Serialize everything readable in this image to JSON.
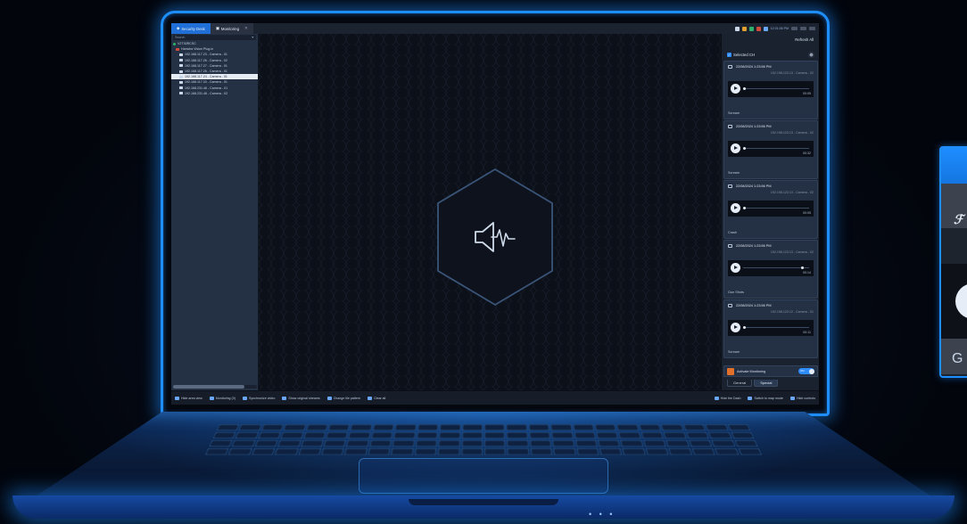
{
  "titlebar": {
    "tabs": [
      {
        "label": "Security Desk",
        "active": true
      },
      {
        "label": "Monitoring",
        "active": false
      }
    ],
    "clock": "12:31:06 PM"
  },
  "left_panel": {
    "search_placeholder": "Search",
    "tree": [
      {
        "label": "V2T30RCSC",
        "kind": "root"
      },
      {
        "label": "Hanwha Vision Plug-in",
        "kind": "plugin"
      },
      {
        "label": "192.168.117.23 - Camera - 01",
        "kind": "camera"
      },
      {
        "label": "192.168.117.26 - Camera - 02",
        "kind": "camera"
      },
      {
        "label": "192.168.117.27 - Camera - 01",
        "kind": "camera"
      },
      {
        "label": "192.168.117.26 - Camera - 01",
        "kind": "camera"
      },
      {
        "label": "192.168.117.24 - Camera - 01",
        "kind": "camera",
        "selected": true
      },
      {
        "label": "192.168.117.33 - Camera - 01",
        "kind": "camera"
      },
      {
        "label": "192.168.231.46 - Camera - 01",
        "kind": "camera"
      },
      {
        "label": "192.168.231.46 - Camera - 02",
        "kind": "camera"
      }
    ]
  },
  "right_panel": {
    "refresh_label": "Refresh All",
    "selected_label": "Selected CH",
    "events": [
      {
        "time": "22/08/2024 1:23:56 PM",
        "camera": "192.198.123.13 - Camera - 02",
        "duration": "00:05",
        "type": "Scream",
        "progress": 0.02
      },
      {
        "time": "22/08/2024 1:23:56 PM",
        "camera": "192.198.123.13 - Camera - 02",
        "duration": "00:32",
        "type": "Scream",
        "progress": 0.02
      },
      {
        "time": "22/08/2024 1:23:56 PM",
        "camera": "192.198.123.13 - Camera - 02",
        "duration": "00:05",
        "type": "Crash",
        "progress": 0.02
      },
      {
        "time": "22/08/2024 1:23:56 PM",
        "camera": "192.198.123.13 - Camera - 02",
        "duration": "00:14",
        "type": "Gun Shots",
        "progress": 0.9
      },
      {
        "time": "22/08/2024 1:23:56 PM",
        "camera": "192.198.123.12 - Camera - 01",
        "duration": "00:11",
        "type": "Scream",
        "progress": 0.02
      }
    ],
    "monitor_label": "Activate Monitoring",
    "toggle_label": "ON",
    "sub_tabs": [
      {
        "label": "General",
        "active": false
      },
      {
        "label": "Special",
        "active": true
      }
    ]
  },
  "toolbar": {
    "items": [
      "Hide area view",
      "Monitoring (0)",
      "Synchronize video",
      "Show original streams",
      "Change tile pattern",
      "Clear all"
    ],
    "right_items": [
      "Hide the Dash",
      "Switch to map mode",
      "Hide controls"
    ]
  },
  "side_card": {
    "footer_text": "G"
  },
  "colors": {
    "accent": "#1e8dff",
    "active_tab": "#1f6fd6",
    "panel": "#243044"
  }
}
